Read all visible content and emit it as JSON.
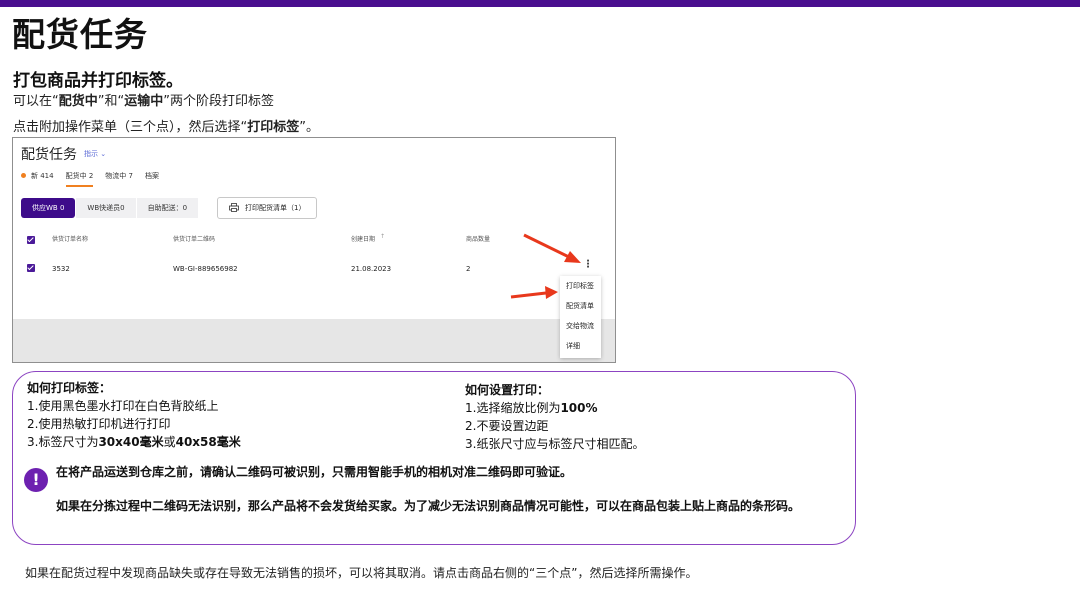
{
  "page_title": "配货任务",
  "section_heading": "打包商品并打印标签。",
  "intro": {
    "prefix": "可以在“",
    "stage1": "配货中",
    "middle": "”和“",
    "stage2": "运输中",
    "suffix": "”两个阶段打印标签"
  },
  "instruction": {
    "prefix": "点击附加操作菜单（三个点），然后选择“",
    "action": "打印标签",
    "suffix": "”。"
  },
  "screenshot": {
    "title": "配货任务",
    "hint_link": "指示",
    "status_tabs": [
      "新 414",
      "配货中 2",
      "物流中 7",
      "档案"
    ],
    "segments": [
      "供应WB 0",
      "WB快递员0",
      "自助配送：0"
    ],
    "print_button": "打印配货清单（1）",
    "table": {
      "headers": [
        "供货订单名称",
        "供货订单二维码",
        "创建日期",
        "商品数量"
      ],
      "row": [
        "3532",
        "WB-GI-889656982",
        "21.08.2023",
        "2"
      ]
    },
    "sort_arrow": "↑",
    "menu_items": [
      "打印标签",
      "配货清单",
      "交给物流",
      "详细"
    ],
    "accent_color": "#4b1a99"
  },
  "info": {
    "left_heading": "如何打印标签：",
    "left_items": [
      "1.使用黑色墨水打印在白色背胶纸上",
      "2.使用热敏打印机进行打印"
    ],
    "left_item3_prefix": "3.标签尺寸为",
    "left_size1": "30x40毫米",
    "left_item3_or": "或",
    "left_size2": "40x58毫米",
    "right_heading": "如何设置打印：",
    "right_item1_prefix": "1.选择缩放比例为",
    "right_item1_value": "100%",
    "right_items": [
      "2.不要设置边距",
      "3.纸张尺寸应与标签尺寸相匹配。"
    ],
    "warning_icon": "!",
    "notice1": "在将产品运送到仓库之前，请确认二维码可被识别，只需用智能手机的相机对准二维码即可验证。",
    "notice2": "如果在分拣过程中二维码无法识别，那么产品将不会发货给买家。为了减少无法识别商品情况可能性，可以在商品包装上贴上商品的条形码。"
  },
  "footer": "如果在配货过程中发现商品缺失或存在导致无法销售的损坏，可以将其取消。请点击商品右侧的“三个点”，然后选择所需操作。",
  "colors": {
    "brand_purple": "#4a0e8f",
    "arrow_red": "#e8381c",
    "tab_orange": "#f08020"
  }
}
